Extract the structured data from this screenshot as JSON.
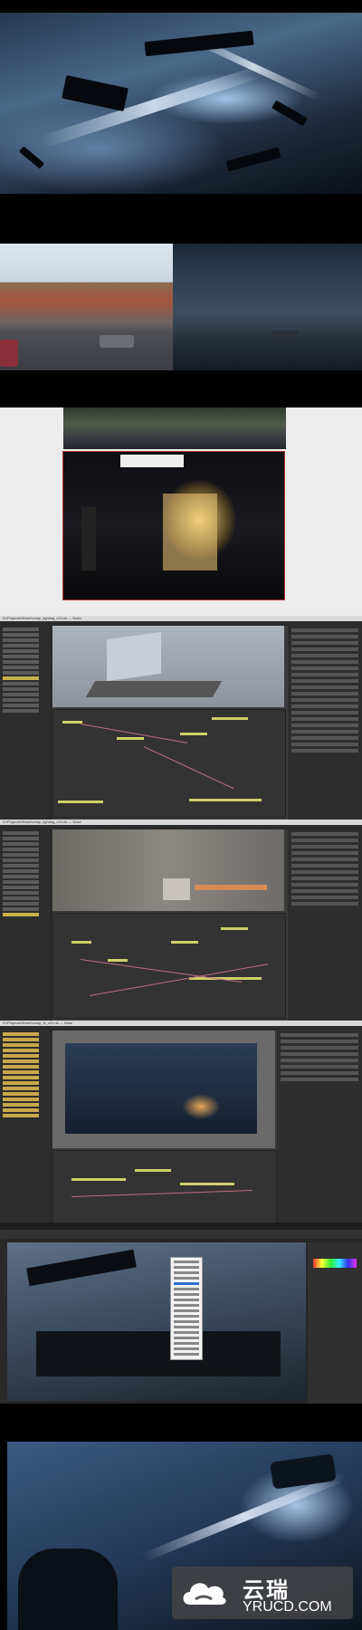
{
  "panels": {
    "render_still": {
      "description_tag": "sci-fi vehicle attack render"
    },
    "street_plates": {
      "description_tag": "street plate vs night lighting"
    },
    "set_photos": {
      "description_tag": "location and stage lighting photos"
    }
  },
  "shots": [
    {
      "window_title": "D:\\Projects\\Street\\comp_lighting_v03.nk — Nuke"
    },
    {
      "window_title": "D:\\Projects\\Street\\comp_lighting_v04.nk — Nuke"
    },
    {
      "window_title": "D:\\Projects\\Street\\comp_fx_v01.nk — Nuke"
    }
  ],
  "photoshop": {
    "menu_items": 22,
    "selected_index": 4
  },
  "watermark": {
    "cn": "云瑞",
    "en": "YRUCD.COM"
  },
  "colors": {
    "accent_node": "#cfcf6a",
    "wire": "#c07080",
    "selection": "#2f6fd0"
  }
}
